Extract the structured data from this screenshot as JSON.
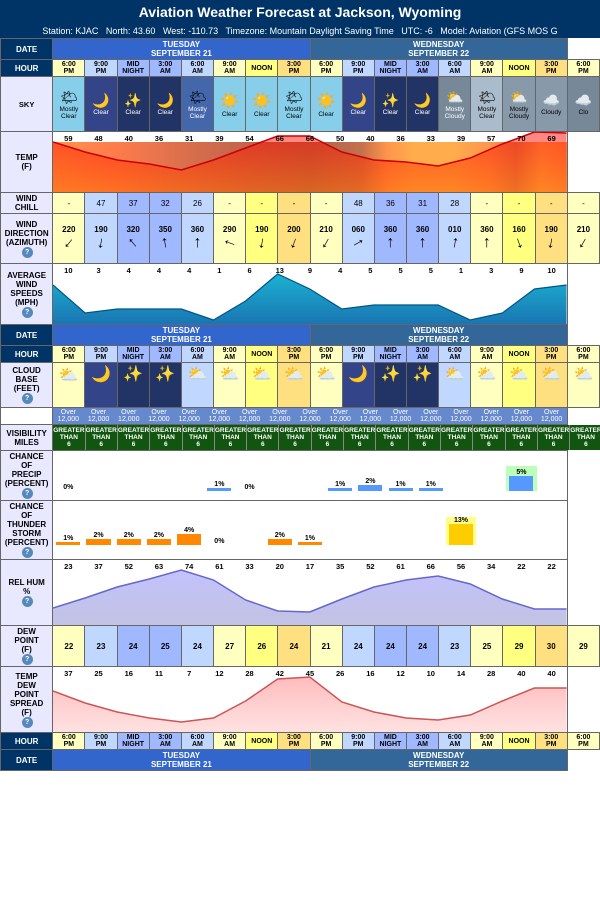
{
  "title": "Aviation Weather Forecast at Jackson, Wyoming",
  "station": {
    "id": "KJAC",
    "north": "43.60",
    "west": "-110.73",
    "timezone": "Mountain Daylight Saving Time",
    "utc": "-6",
    "model": "Aviation (GFS MOS G"
  },
  "dates": {
    "tuesday": "TUESDAY\nSEPTEMBER 21",
    "wednesday": "WEDNESDAY\nSEPTEMBER 22"
  },
  "hours": [
    "6:00\nPM",
    "9:00\nPM",
    "MID\nNIGHT",
    "3:00\nAM",
    "6:00\nAM",
    "9:00\nAM",
    "NOON",
    "3:00\nPM",
    "6:00\nPM",
    "9:00\nPM",
    "MID\nNIGHT",
    "3:00\nAM",
    "6:00\nAM",
    "9:00\nAM",
    "NOON",
    "3:00\nPM",
    "6:00\nPM"
  ],
  "sky": [
    "Mostly Clear",
    "Clear",
    "Clear",
    "Clear",
    "Mostly Clear",
    "Clear",
    "Clear",
    "Mostly Clear",
    "Clear",
    "Clear",
    "Clear",
    "Clear",
    "Mostly Cloudy",
    "Mostly Clear",
    "Mostly Cloudy",
    "Cloudy",
    "Clo"
  ],
  "temp": [
    59,
    48,
    40,
    36,
    31,
    39,
    54,
    66,
    66,
    50,
    40,
    36,
    33,
    39,
    57,
    70,
    69
  ],
  "windchill": [
    "-",
    47,
    37,
    32,
    26,
    "-",
    "-",
    "-",
    "-",
    48,
    36,
    31,
    28,
    "-",
    "-",
    "-",
    "-"
  ],
  "winddir": [
    220,
    190,
    320,
    350,
    360,
    290,
    190,
    200,
    210,
    60,
    360,
    360,
    10,
    360,
    160,
    190,
    210
  ],
  "windspeed": [
    10,
    3,
    4,
    4,
    4,
    1,
    6,
    13,
    9,
    4,
    5,
    5,
    5,
    1,
    3,
    9,
    10
  ],
  "cloudbase_text": "Over 12,000",
  "visibility": [
    "GREATER THAN 6",
    "GREATER THAN 6",
    "GREATER THAN 6",
    "GREATER THAN 6",
    "GREATER THAN 6",
    "GREATER THAN 6",
    "GREATER THAN 6",
    "GREATER THAN 6",
    "GREATER THAN 6",
    "GREATER THAN 6",
    "GREATER THAN 6",
    "GREATER THAN 6",
    "GREATER THAN 6",
    "GREATER THAN 6",
    "GREATER THAN 6",
    "GREATER THAN 6",
    "GREATER THAN 6"
  ],
  "precip_pct": [
    0,
    0,
    0,
    0,
    0,
    1,
    0,
    0,
    0,
    1,
    2,
    1,
    1,
    0,
    0,
    5,
    0
  ],
  "thunder_pct": [
    1,
    2,
    2,
    2,
    4,
    0,
    0,
    2,
    1,
    0,
    0,
    0,
    0,
    13,
    0,
    0,
    0
  ],
  "rel_hum": [
    23,
    37,
    52,
    63,
    74,
    61,
    33,
    20,
    17,
    35,
    52,
    61,
    66,
    56,
    34,
    22,
    22
  ],
  "dew_point": [
    22,
    23,
    24,
    25,
    24,
    27,
    26,
    24,
    21,
    24,
    24,
    24,
    23,
    25,
    29,
    30,
    29
  ],
  "temp_dew_spread": [
    37,
    25,
    16,
    11,
    7,
    12,
    28,
    42,
    45,
    26,
    16,
    12,
    10,
    14,
    28,
    40,
    40
  ],
  "labels": {
    "date": "DATE",
    "hour": "HOUR",
    "sky": "SKY",
    "temp": "TEMP\n(F)",
    "windchill": "WIND\nCHILL",
    "winddir": "WIND\nDIRECTION\n(AZIMUTH)",
    "windspeed": "AVERAGE\nWIND\nSPEEDS\n(MPH)",
    "cloudbase": "CLOUD\nBASE\n(FEET)",
    "visibility": "VISIBILITY\nMILES",
    "precip": "CHANCE\nOF\nPRECIP\n(PERCENT)",
    "thunder": "CHANCE\nOF\nTHUNDER\nSTORM\n(PERCENT)",
    "relhum": "REL HUM\n%",
    "dewpoint": "DEW\nPOINT\n(F)",
    "spread": "TEMP\nDEW\nPOINT\nSPREAD\n(F)"
  }
}
